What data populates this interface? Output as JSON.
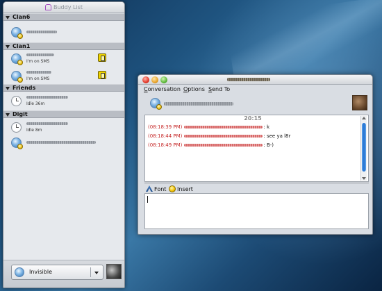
{
  "buddy_list": {
    "title": "Buddy List",
    "groups": [
      {
        "name": "Clan6"
      },
      {
        "name": "Clan1",
        "buddies_status": [
          "I'm on SMS",
          "I'm on SMS"
        ]
      },
      {
        "name": "Friends",
        "buddies_status": [
          "Idle 36m"
        ]
      },
      {
        "name": "Digit",
        "buddies_status": [
          "Idle 8m"
        ]
      }
    ],
    "status": {
      "label": "Invisible"
    },
    "icons": {
      "group_toggle": "expander-triangle-icon",
      "buddy": "buddy-avatar-icon",
      "idle": "idle-clock-icon",
      "sms": "sms-phone-icon"
    }
  },
  "conversation": {
    "menu": [
      "Conversation",
      "Options",
      "Send To"
    ],
    "history": {
      "timestamp_header": "20:15",
      "messages": [
        {
          "time": "(08:18:39 PM)",
          "text": ": k"
        },
        {
          "time": "(08:18:44 PM)",
          "text": ": see ya l8r"
        },
        {
          "time": "(08:18:49 PM)",
          "text": ": B-)"
        }
      ]
    },
    "toolbar": {
      "font_label": "Font",
      "insert_label": "Insert"
    },
    "input": {
      "value": ""
    }
  },
  "colors": {
    "timestamp": "#c62828",
    "scroll_thumb": "#1f6fcf",
    "close_button": "#e2382a",
    "minimize_button": "#e7a22a",
    "maximize_button": "#5cb83a"
  }
}
